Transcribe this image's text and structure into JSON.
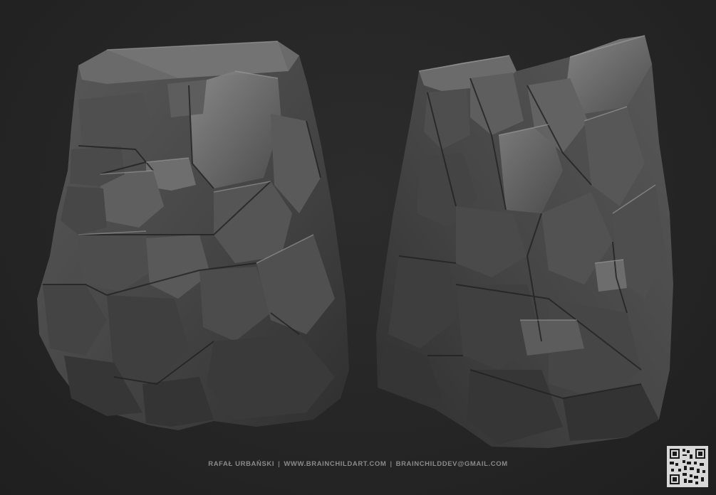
{
  "footer": {
    "author": "RAFAŁ URBAŃSKI",
    "website": "WWW.BRAINCHILDART.COM",
    "email": "BRAINCHILDDEV@GMAIL.COM",
    "separator": "|"
  },
  "colors": {
    "background": "#262626",
    "rock_base": "#4a4a4a",
    "rock_highlight": "#8c8c8c",
    "rock_shadow": "#2a2a2a",
    "footer_text": "#8a8a8a"
  },
  "icons": {
    "qr": "qr-code-icon"
  }
}
